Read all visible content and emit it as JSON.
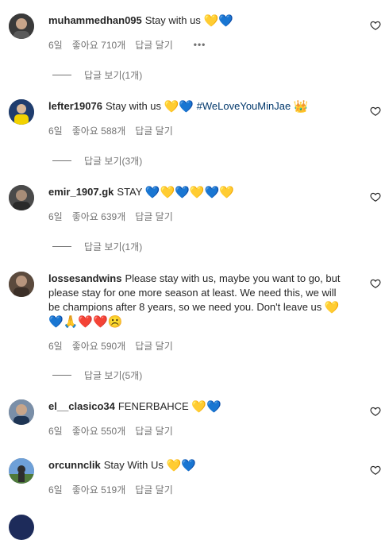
{
  "colors": {
    "yellow_heart": "#f5c800",
    "blue_heart": "#1b6fd6",
    "hashtag": "#00376b",
    "muted": "#737373"
  },
  "comments": [
    {
      "user": "muhammedhan095",
      "text": "Stay with us",
      "emoji": "💛💙",
      "age": "6일",
      "likes": "좋아요 710개",
      "reply": "답글 달기",
      "more": "•••",
      "view_replies": "답글 보기(1개)"
    },
    {
      "user": "lefter19076",
      "text": "Stay with us",
      "emoji": "💛💙",
      "hashtag": "#WeLoveYouMinJae",
      "extra_emoji": "👑",
      "age": "6일",
      "likes": "좋아요 588개",
      "reply": "답글 달기",
      "view_replies": "답글 보기(3개)"
    },
    {
      "user": "emir_1907.gk",
      "text": "STAY",
      "emoji": "💙💛💙💛💙💛",
      "age": "6일",
      "likes": "좋아요 639개",
      "reply": "답글 달기",
      "view_replies": "답글 보기(1개)"
    },
    {
      "user": "lossesandwins",
      "text": "Please stay with us, maybe you want to go, but please stay for one more season at least. We need this, we will be champions after 8 years, so we need you. Don't leave us",
      "emoji": "💛💙🙏❤️❤️☹️",
      "age": "6일",
      "likes": "좋아요 590개",
      "reply": "답글 달기",
      "view_replies": "답글 보기(5개)"
    },
    {
      "user": "el__clasico34",
      "text": "FENERBAHCE",
      "emoji": "💛💙",
      "age": "6일",
      "likes": "좋아요 550개",
      "reply": "답글 달기"
    },
    {
      "user": "orcunnclik",
      "text": "Stay With Us",
      "emoji": "💛💙",
      "age": "6일",
      "likes": "좋아요 519개",
      "reply": "답글 달기"
    }
  ],
  "icons": {
    "like": "heart-outline-icon"
  }
}
